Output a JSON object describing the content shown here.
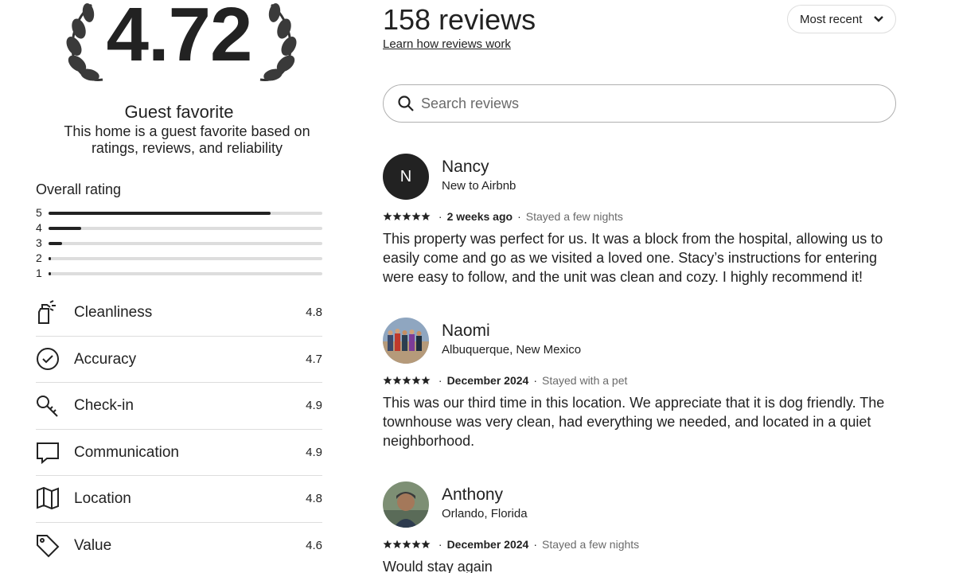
{
  "summary": {
    "score": "4.72",
    "badge_title": "Guest favorite",
    "badge_desc": "This home is a guest favorite based on ratings, reviews, and reliability"
  },
  "overall": {
    "title": "Overall rating",
    "rows": [
      {
        "label": "5",
        "fraction": 0.81
      },
      {
        "label": "4",
        "fraction": 0.12
      },
      {
        "label": "3",
        "fraction": 0.05
      },
      {
        "label": "2",
        "fraction": 0.01
      },
      {
        "label": "1",
        "fraction": 0.01
      }
    ]
  },
  "categories": [
    {
      "label": "Cleanliness",
      "value": "4.8",
      "icon": "spray-bottle-icon"
    },
    {
      "label": "Accuracy",
      "value": "4.7",
      "icon": "check-circle-icon"
    },
    {
      "label": "Check-in",
      "value": "4.9",
      "icon": "key-icon"
    },
    {
      "label": "Communication",
      "value": "4.9",
      "icon": "message-bubble-icon"
    },
    {
      "label": "Location",
      "value": "4.8",
      "icon": "map-icon"
    },
    {
      "label": "Value",
      "value": "4.6",
      "icon": "price-tag-icon"
    }
  ],
  "header": {
    "count": "158 reviews",
    "learn_link": "Learn how reviews work",
    "sort_label": "Most recent"
  },
  "search": {
    "placeholder": "Search reviews",
    "value": ""
  },
  "reviews": [
    {
      "avatar_letter": "N",
      "name": "Nancy",
      "location": "New to Airbnb",
      "stars": 5,
      "date": "2 weeks ago",
      "stay": "Stayed a few nights",
      "text": "This property was perfect for us. It was a block from the hospital, allowing us to easily come and go as we visited a loved one. Stacy’s instructions for entering were easy to follow, and the unit was clean and cozy. I highly recommend it!"
    },
    {
      "avatar_letter": "",
      "name": "Naomi",
      "location": "Albuquerque, New Mexico",
      "stars": 5,
      "date": "December 2024",
      "stay": "Stayed with a pet",
      "text": "This was our third time in this location. We appreciate that it is dog friendly. The townhouse was very clean, had everything we needed, and located in a quiet neighborhood."
    },
    {
      "avatar_letter": "",
      "name": "Anthony",
      "location": "Orlando, Florida",
      "stars": 5,
      "date": "December 2024",
      "stay": "Stayed a few nights",
      "text": "Would stay again"
    }
  ]
}
